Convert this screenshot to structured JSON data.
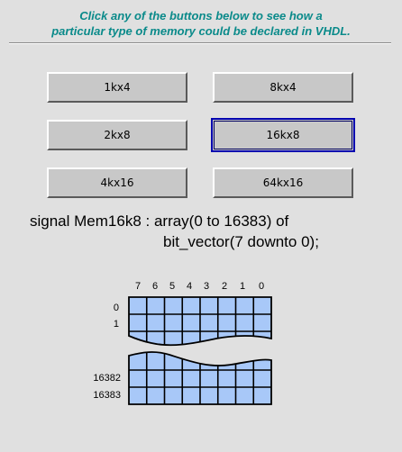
{
  "instructions": {
    "line1": "Click any of the buttons below to see how a",
    "line2": "particular type of memory could be declared in VHDL."
  },
  "buttons": [
    {
      "label": "1kx4"
    },
    {
      "label": "8kx4"
    },
    {
      "label": "2kx8"
    },
    {
      "label": "16kx8",
      "selected": true
    },
    {
      "label": "4kx16"
    },
    {
      "label": "64kx16"
    }
  ],
  "declaration": {
    "line1": "signal Mem16k8 : array(0 to 16383) of",
    "line2": "bit_vector(7 downto 0);"
  },
  "diagram": {
    "bit_labels": [
      "7",
      "6",
      "5",
      "4",
      "3",
      "2",
      "1",
      "0"
    ],
    "row_labels_top": [
      "0",
      "1"
    ],
    "row_labels_bottom": [
      "16382",
      "16383"
    ],
    "cell_color": "#a8c8f8"
  }
}
